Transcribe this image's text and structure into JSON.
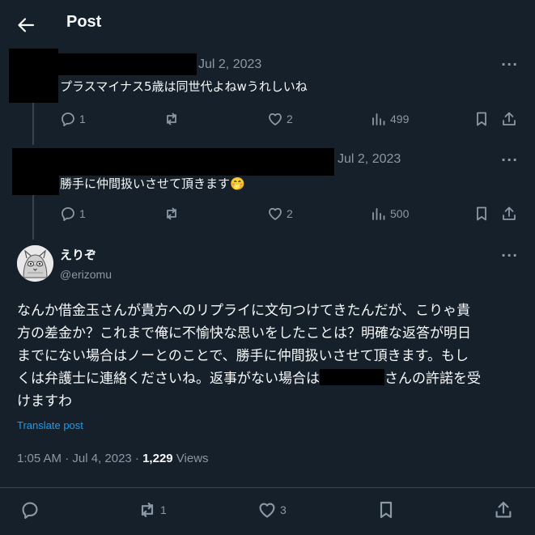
{
  "header": {
    "title": "Post"
  },
  "replies": [
    {
      "date": "Jul 2, 2023",
      "text": "プラスマイナス5歳は同世代よねwうれしいね",
      "replies": "1",
      "reposts": "",
      "likes": "2",
      "views": "499"
    },
    {
      "date": "Jul 2, 2023",
      "text": "勝手に仲間扱いさせて頂きます🤭",
      "replies": "1",
      "reposts": "",
      "likes": "2",
      "views": "500"
    }
  ],
  "main_post": {
    "name": "えりぞ",
    "handle": "@erizomu",
    "lines": [
      "なんか借金玉さんが貴方へのリプライに文句つけてきたんだが、こりゃ貴",
      "方の差金か？これまで俺に不愉快な思いをしたことは？明確な返答が明日",
      "までにない場合はノーとのことで、勝手に仲間扱いさせて頂きます。もし",
      "くは弁護士に連絡くださいね。返事がない場合は",
      "さんの許諾を受",
      "けますわ"
    ],
    "translate": "Translate post",
    "time": "1:05 AM · Jul 4, 2023 · ",
    "views_count": "1,229",
    "views_label": " Views",
    "reposts": "1",
    "likes": "3"
  },
  "icons": {
    "back": "arrow-left-icon",
    "more": "more-dots-icon",
    "reply": "reply-bubble-icon",
    "repost": "repost-icon",
    "like": "heart-icon",
    "views": "analytics-icon",
    "bookmark": "bookmark-icon",
    "share": "share-icon"
  },
  "colors": {
    "background": "#15202b",
    "text": "#f7f9f9",
    "muted": "#8b98a5",
    "link": "#1d9bf0",
    "divider": "#38444d"
  }
}
